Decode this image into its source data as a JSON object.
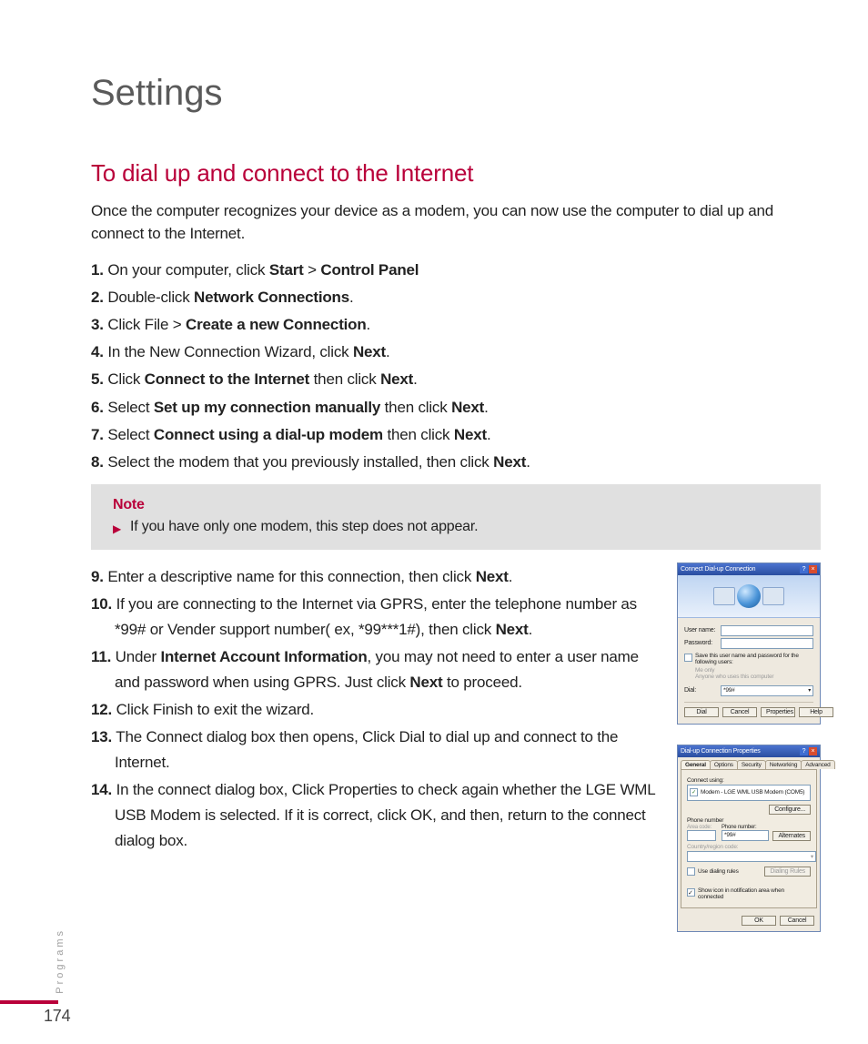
{
  "page_title": "Settings",
  "section_title": "To dial up and connect to the Internet",
  "intro": "Once the computer recognizes your device as a modem, you can now use the computer to dial up and connect to the Internet.",
  "steps": {
    "s1_pre": "On your computer, click ",
    "s1_b1": "Start",
    "s1_sep": " > ",
    "s1_b2": "Control Panel",
    "s2_pre": "Double-click ",
    "s2_b1": "Network Connections",
    "s2_post": ".",
    "s3_pre": "Click File > ",
    "s3_b1": "Create a new Connection",
    "s3_post": ".",
    "s4_pre": "In the New Connection Wizard, click ",
    "s4_b1": "Next",
    "s4_post": ".",
    "s5_pre": "Click ",
    "s5_b1": "Connect to the Internet",
    "s5_mid": " then click ",
    "s5_b2": "Next",
    "s5_post": ".",
    "s6_pre": "Select ",
    "s6_b1": "Set up my connection manually",
    "s6_mid": " then click ",
    "s6_b2": "Next",
    "s6_post": ".",
    "s7_pre": "Select ",
    "s7_b1": "Connect using a dial-up modem",
    "s7_mid": " then click ",
    "s7_b2": "Next",
    "s7_post": ".",
    "s8_pre": "Select the modem that you previously installed, then click ",
    "s8_b1": "Next",
    "s8_post": ".",
    "s9_pre": "Enter a descriptive name for this connection, then click ",
    "s9_b1": "Next",
    "s9_post": ".",
    "s10_pre": "If you are connecting to the Internet via GPRS, enter the telephone number as *99# or Vender support number( ex, *99***1#), then click ",
    "s10_b1": "Next",
    "s10_post": ".",
    "s11_pre": "Under ",
    "s11_b1": "Internet Account Information",
    "s11_mid": ", you may not need to enter a user name and password when using GPRS. Just click ",
    "s11_b2": "Next",
    "s11_post": " to proceed.",
    "s12": "Click Finish to exit the wizard.",
    "s13": "The Connect dialog box then opens, Click Dial to dial up and connect to the Internet.",
    "s14": "In the connect dialog box, Click Properties to check again whether the LGE WML USB Modem is selected. If it is correct, click OK, and then, return to the connect dialog box."
  },
  "note": {
    "label": "Note",
    "text": "If you have only one modem, this step does not appear."
  },
  "dialog1": {
    "title": "Connect Dial-up Connection",
    "username_label": "User name:",
    "password_label": "Password:",
    "save_label": "Save this user name and password for the following users:",
    "opt_me": "Me only",
    "opt_anyone": "Anyone who uses this computer",
    "dial_label": "Dial:",
    "dial_value": "*99#",
    "btn_dial": "Dial",
    "btn_cancel": "Cancel",
    "btn_properties": "Properties",
    "btn_help": "Help"
  },
  "dialog2": {
    "title": "Dial-up Connection Properties",
    "tabs": [
      "General",
      "Options",
      "Security",
      "Networking",
      "Advanced"
    ],
    "connect_using": "Connect using:",
    "modem_item": "Modem - LGE WML USB Modem (COM5)",
    "btn_configure": "Configure...",
    "phone_label": "Phone number",
    "area_label": "Area code:",
    "phone_num_label": "Phone number:",
    "phone_value": "*99#",
    "btn_alternates": "Alternates",
    "country_label": "Country/region code:",
    "use_dialing": "Use dialing rules",
    "btn_dialing": "Dialing Rules",
    "show_icon": "Show icon in notification area when connected",
    "btn_ok": "OK",
    "btn_cancel": "Cancel"
  },
  "side_tab": "Programs",
  "page_number": "174"
}
